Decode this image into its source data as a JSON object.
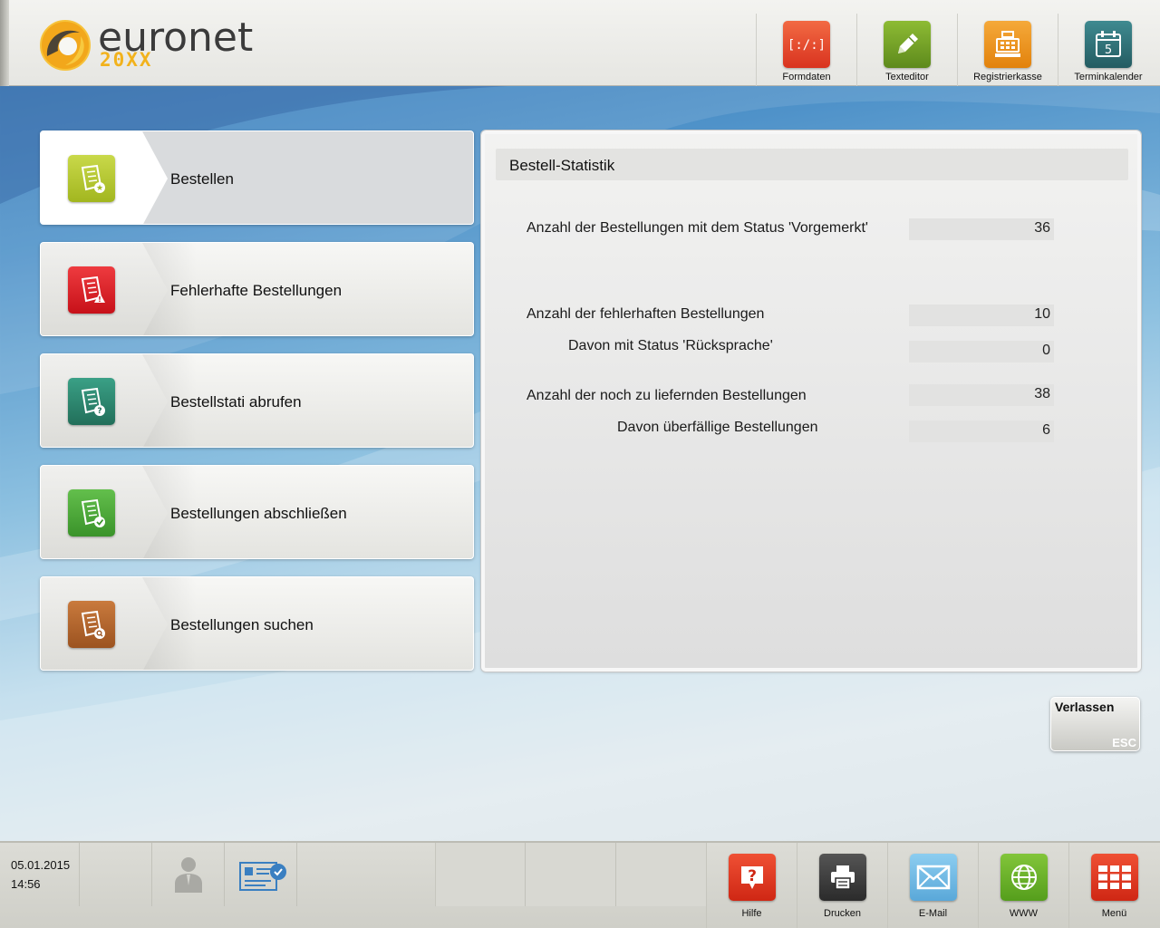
{
  "app": {
    "logo_name": "euronet",
    "logo_sub": "20XX"
  },
  "toolbar": {
    "items": [
      {
        "label": "Formdaten",
        "icon": "form-data-icon",
        "color": "#e5442a"
      },
      {
        "label": "Texteditor",
        "icon": "pencil-icon",
        "color": "#6d9a24"
      },
      {
        "label": "Registrierkasse",
        "icon": "cash-register-icon",
        "color": "#e98d12"
      },
      {
        "label": "Terminkalender",
        "icon": "calendar-icon",
        "color": "#2f6f75",
        "calendar_day": "5"
      }
    ]
  },
  "menu": {
    "items": [
      {
        "label": "Bestellen",
        "icon": "order-new-icon",
        "color": "#b5c931",
        "active": true
      },
      {
        "label": "Fehlerhafte Bestellungen",
        "icon": "order-error-icon",
        "color": "#e0232c",
        "active": false
      },
      {
        "label": "Bestellstati abrufen",
        "icon": "order-status-icon",
        "color": "#2f8a72",
        "active": false
      },
      {
        "label": "Bestellungen abschließen",
        "icon": "order-complete-icon",
        "color": "#4caa3a",
        "active": false
      },
      {
        "label": "Bestellungen suchen",
        "icon": "order-search-icon",
        "color": "#b8682e",
        "active": false
      }
    ]
  },
  "stats": {
    "title": "Bestell-Statistik",
    "rows": [
      {
        "label": "Anzahl der Bestellungen mit dem Status 'Vorgemerkt'",
        "value": "36"
      },
      {
        "label": "Anzahl der fehlerhaften Bestellungen",
        "value": "10"
      },
      {
        "label": "Davon mit Status 'Rücksprache'",
        "value": "0"
      },
      {
        "label": "Anzahl der noch zu liefernden Bestellungen",
        "value": "38"
      },
      {
        "label": "Davon überfällige Bestellungen",
        "value": "6"
      }
    ]
  },
  "exit": {
    "label": "Verlassen",
    "key": "ESC"
  },
  "footer": {
    "date": "05.01.2015",
    "time": "14:56",
    "buttons": [
      {
        "label": "Hilfe",
        "icon": "help-icon",
        "color": "#e03a26"
      },
      {
        "label": "Drucken",
        "icon": "printer-icon",
        "color": "#3d3d3d"
      },
      {
        "label": "E-Mail",
        "icon": "mail-icon",
        "color": "#6fb7e3"
      },
      {
        "label": "WWW",
        "icon": "globe-icon",
        "color": "#6cb22b"
      },
      {
        "label": "Menü",
        "icon": "menu-grid-icon",
        "color": "#e03a26"
      }
    ]
  }
}
